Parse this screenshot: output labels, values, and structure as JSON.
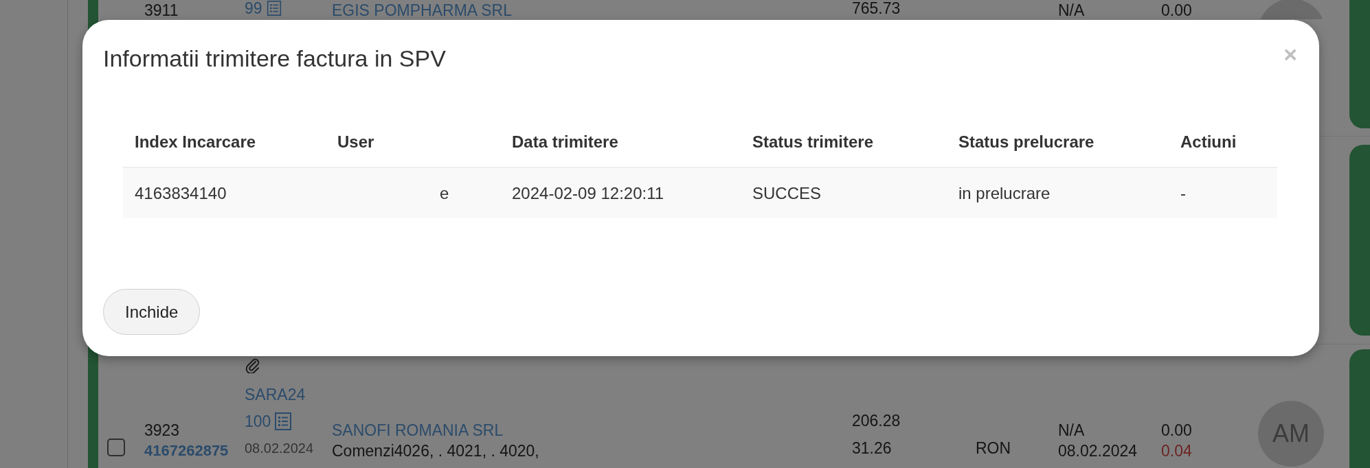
{
  "background_list": {
    "rows": [
      {
        "kind": "cut_top",
        "column_1": {
          "number": "3911"
        },
        "column_2": {
          "document": "99"
        },
        "column_3": {
          "client": "EGIS POMPHARMA SRL"
        },
        "column_4": [
          "765.73"
        ],
        "column_6": [
          "N/A"
        ],
        "column_7": [
          {
            "text": "0.00",
            "color": "#141414"
          }
        ]
      },
      {
        "kind": "covered"
      },
      {
        "kind": "full",
        "checked": false,
        "column_1": {
          "number": "3923",
          "link": "4167262875"
        },
        "column_2": {
          "attachment": true,
          "series": "SARA24",
          "document": "100",
          "date": "08.02.2024"
        },
        "column_3": {
          "client": "SANOFI ROMANIA SRL",
          "note": "Comenzi4026, . 4021, . 4020,"
        },
        "column_4": [
          "206.28",
          "31.26"
        ],
        "column_5": "RON",
        "column_6": [
          "N/A",
          "08.02.2024"
        ],
        "column_7": [
          {
            "text": "0.00",
            "color": "#141414"
          },
          {
            "text": "0.04",
            "color": "#6b2422"
          }
        ],
        "avatar": "AM"
      }
    ]
  },
  "modal": {
    "title": "Informatii trimitere factura in SPV",
    "close": "×",
    "table": {
      "columns": [
        "Index Incarcare",
        "User",
        "Data trimitere",
        "Status trimitere",
        "Status prelucrare",
        "Actiuni"
      ],
      "rows": [
        {
          "cells": [
            {
              "text": "4163834140",
              "redacted": false
            },
            {
              "text": "e",
              "redacted": true
            },
            {
              "text": "2024-02-09 12:20:11",
              "redacted": false
            },
            {
              "text": "SUCCES",
              "redacted": false
            },
            {
              "text": "in prelucrare",
              "redacted": false
            },
            {
              "text": "-",
              "redacted": false
            }
          ]
        }
      ]
    },
    "buttons": [
      "Inchide"
    ]
  }
}
